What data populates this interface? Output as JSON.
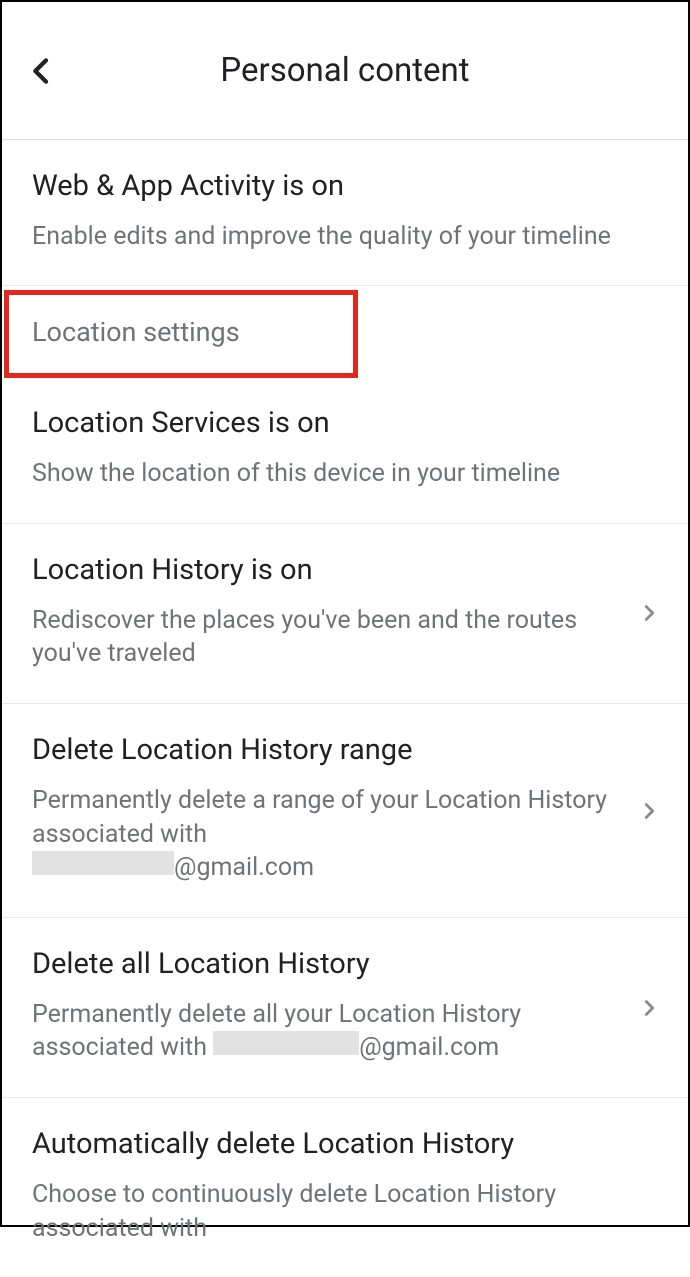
{
  "header": {
    "title": "Personal content"
  },
  "sections": {
    "webActivity": {
      "title": "Web & App Activity is on",
      "subtitle": "Enable edits and improve the quality of your timeline"
    },
    "locationSettingsHeader": "Location settings",
    "locationServices": {
      "title": "Location Services is on",
      "subtitle": "Show the location of this device in your timeline"
    },
    "locationHistory": {
      "title": "Location History is on",
      "subtitle": "Rediscover the places you've been and the routes you've traveled"
    },
    "deleteRange": {
      "title": "Delete Location History range",
      "subtitlePrefix": "Permanently delete a range of your Location History associated with ",
      "emailSuffix": "@gmail.com"
    },
    "deleteAll": {
      "title": "Delete all Location History",
      "subtitlePrefix": "Permanently delete all your Location History associated with ",
      "emailSuffix": "@gmail.com"
    },
    "autoDelete": {
      "title": "Automatically delete Location History",
      "subtitle": "Choose to continuously delete Location History associated with"
    }
  }
}
